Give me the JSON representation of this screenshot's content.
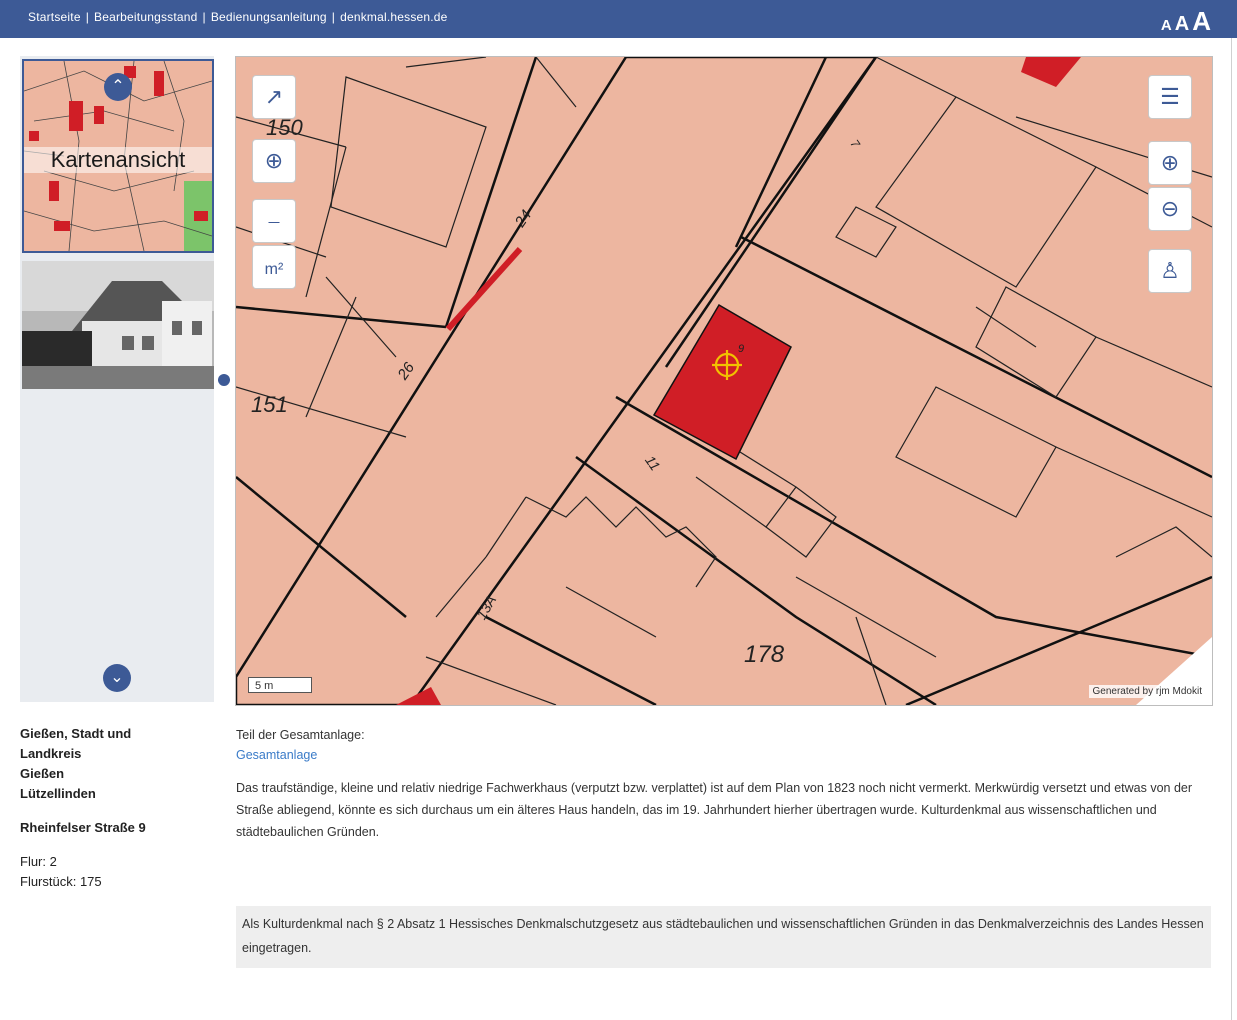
{
  "topnav": {
    "items": [
      "Startseite",
      "Bearbeitungsstand",
      "Bedienungsanleitung",
      "denkmal.hessen.de"
    ],
    "separator": "|"
  },
  "fontsize": {
    "small": "A",
    "medium": "A",
    "large": "A"
  },
  "sidebar": {
    "map_thumb_label": "Kartenansicht",
    "up_icon": "chevron-up-icon",
    "down_icon": "chevron-down-icon"
  },
  "map": {
    "parcel_labels": [
      "150",
      "151",
      "178",
      "24",
      "26",
      "11",
      "13A",
      "7",
      "9"
    ],
    "scale_label": "5 m",
    "attribution": "Generated by rjm Mdokit",
    "tools_left": [
      "select-extent-icon",
      "locate-crosshair-icon",
      "measure-distance-icon",
      "measure-area-icon"
    ],
    "tools_right": [
      "layers-icon",
      "zoom-in-icon",
      "zoom-out-icon",
      "streetview-person-icon"
    ],
    "colors": {
      "parcel": "#edb6a0",
      "monument": "#d01e26",
      "lines": "#111111",
      "marker": "#f2c200"
    }
  },
  "info": {
    "location_lines": [
      "Gießen, Stadt und",
      "Landkreis",
      "Gießen",
      "Lützellinden"
    ],
    "street": "Rheinfelser Straße 9",
    "flur": "Flur: 2",
    "flurstueck": "Flurstück: 175",
    "teil_label": "Teil der Gesamtanlage:",
    "gesamtanlage_link": "Gesamtanlage",
    "description": "Das traufständige, kleine und relativ niedrige Fachwerkhaus (verputzt bzw. verplattet) ist auf dem Plan von 1823 noch nicht vermerkt. Merkwürdig versetzt und etwas von der Straße abliegend, könnte es sich durchaus um ein älteres Haus handeln, das im 19. Jahrhundert hierher übertragen wurde. Kulturdenkmal aus wissenschaftlichen und städtebaulichen Gründen.",
    "notice": "Als Kulturdenkmal nach § 2 Absatz 1 Hessisches Denkmalschutzgesetz aus städtebaulichen und wissenschaftlichen Gründen in das Denkmalverzeichnis des Landes Hessen eingetragen."
  }
}
